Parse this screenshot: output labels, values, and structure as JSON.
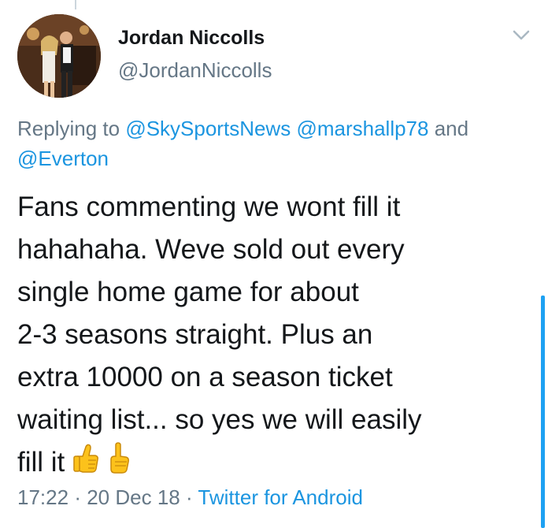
{
  "author": {
    "display_name": "Jordan Niccolls",
    "handle": "@JordanNiccolls"
  },
  "reply": {
    "prefix": "Replying to",
    "mentions": [
      "@SkySportsNews",
      "@marshallp78"
    ],
    "joiner": "and",
    "last_mention": "@Everton"
  },
  "tweet": {
    "lines": [
      "Fans commenting we wont fill it",
      "hahahaha. Weve sold out every",
      "single home game for about",
      "2-3 seasons straight. Plus an",
      "extra 10000 on a season ticket",
      "waiting list... so yes we will easily",
      "fill it"
    ],
    "emojis": [
      "thumbs-up-emoji",
      "pointing-up-emoji"
    ]
  },
  "meta": {
    "time": "17:22",
    "separator": "·",
    "date": "20 Dec 18",
    "source": "Twitter for Android"
  },
  "colors": {
    "text": "#14171a",
    "secondary": "#657786",
    "link": "#1b95e0",
    "scrollbar": "#1da1f2"
  },
  "icons": [
    "chevron-down-icon"
  ]
}
